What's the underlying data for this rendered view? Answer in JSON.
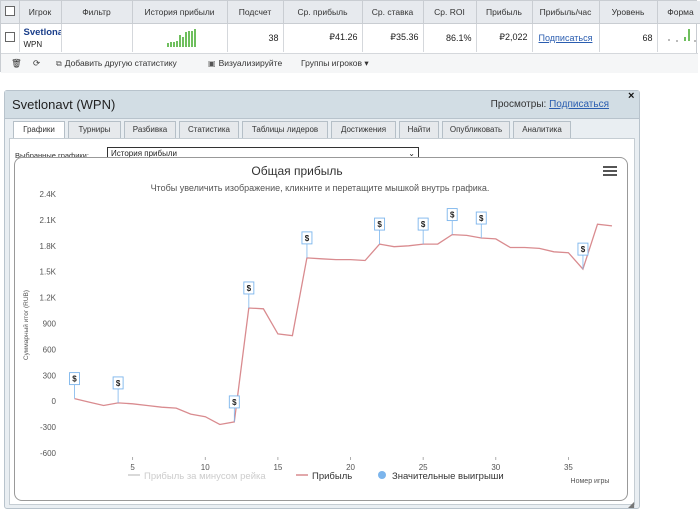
{
  "stats_table": {
    "headers": [
      "Игрок",
      "Фильтр",
      "История прибыли",
      "Подсчет",
      "Ср. прибыль",
      "Ср. ставка",
      "Ср. ROI",
      "Прибыль",
      "Прибыль/час",
      "Уровень",
      "Форма"
    ],
    "row": {
      "player": "Svetlonavt",
      "network": "WPN",
      "count": "38",
      "avg_profit": "₽41.26",
      "avg_stake": "₽35.36",
      "avg_roi": "86.1%",
      "profit": "₽2,022",
      "profit_hour": "Подписаться",
      "level": "68",
      "remove": "x"
    }
  },
  "toolbar": {
    "add_stat": "Добавить другую статистику",
    "visualize": "Визуализируйте",
    "player_groups": "Группы игроков"
  },
  "panel": {
    "title": "Svetlonavt (WPN)",
    "views_label": "Просмотры:",
    "views_link": "Подписаться",
    "tabs": [
      "Графики",
      "Турниры",
      "Разбивка",
      "Статистика",
      "Таблицы лидеров",
      "Достижения",
      "Найти",
      "Опубликовать",
      "Аналитика"
    ],
    "selected_label": "Выбранные графики:",
    "selected_value": "История прибыли"
  },
  "chart_data": {
    "type": "line",
    "title": "Общая прибыль",
    "subtitle": "Чтобы увеличить изображение, кликните и перетащите мышкой внутрь графика.",
    "ylabel": "Суммарный итог (RUB)",
    "xlabel": "Номер игры",
    "y_ticks": [
      "2.4K",
      "2.1K",
      "1.8K",
      "1.5K",
      "1.2K",
      "900",
      "600",
      "300",
      "0",
      "-300",
      "-600"
    ],
    "x_ticks": [
      "5",
      "10",
      "15",
      "20",
      "25",
      "30",
      "35"
    ],
    "ylim": [
      -600,
      2400
    ],
    "xlim": [
      0,
      38
    ],
    "series": [
      {
        "name": "Прибыль за минусом рейка",
        "color": "#cccccc",
        "x": [],
        "y": []
      },
      {
        "name": "Прибыль",
        "color": "#d98b8f",
        "x": [
          1,
          2,
          3,
          4,
          5,
          6,
          7,
          8,
          9,
          10,
          11,
          12,
          13,
          14,
          15,
          16,
          17,
          18,
          19,
          20,
          21,
          22,
          23,
          24,
          25,
          26,
          27,
          28,
          29,
          30,
          31,
          32,
          33,
          34,
          35,
          36,
          37,
          38
        ],
        "y": [
          30,
          -10,
          -50,
          -20,
          -30,
          -50,
          -70,
          -80,
          -150,
          -180,
          -270,
          -240,
          1080,
          1070,
          780,
          760,
          1660,
          1650,
          1640,
          1640,
          1630,
          1820,
          1790,
          1800,
          1820,
          1820,
          1930,
          1920,
          1890,
          1880,
          1780,
          1780,
          1770,
          1730,
          1720,
          1530,
          2050,
          2030
        ]
      },
      {
        "name": "Значительные выигрыши",
        "color": "#7cb5ec",
        "x": [],
        "y": []
      }
    ],
    "big_wins": [
      1,
      4,
      12,
      13,
      17,
      22,
      25,
      27,
      29,
      36
    ],
    "marker_label": "$"
  }
}
